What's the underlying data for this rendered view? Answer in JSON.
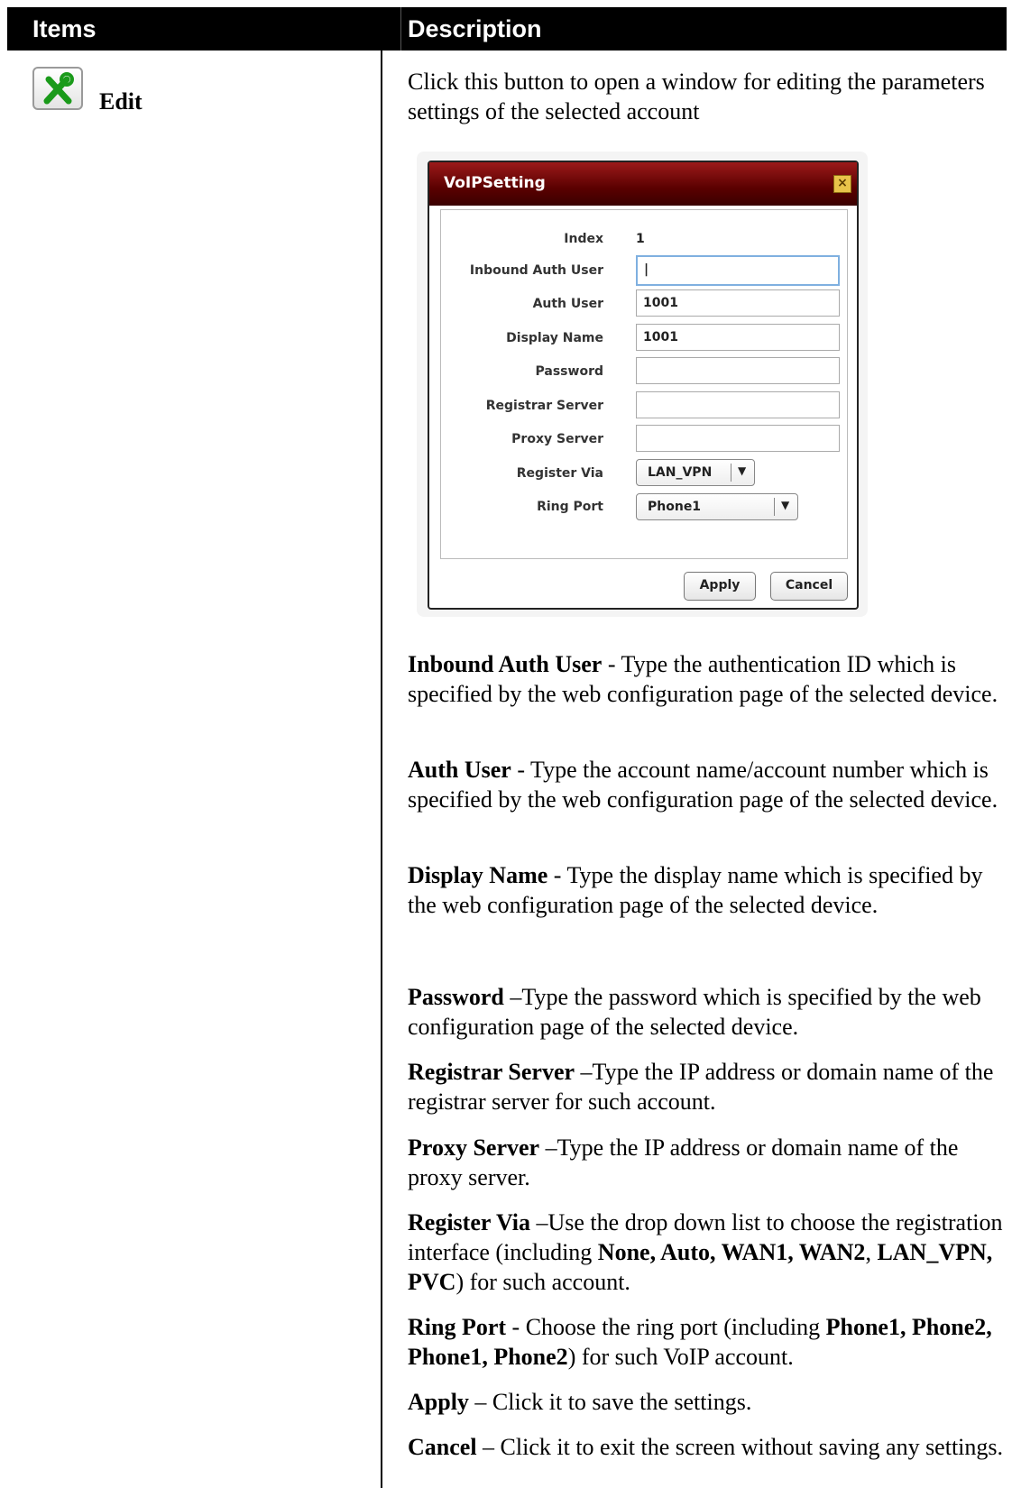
{
  "table": {
    "header_items": "Items",
    "header_description": "Description"
  },
  "item": {
    "icon": "edit-tools-icon",
    "label": "Edit"
  },
  "intro": "Click this button to open a window for editing the parameters settings of the selected account",
  "dialog": {
    "title": "VoIPSetting",
    "fields": {
      "index_label": "Index",
      "index_value": "1",
      "inbound_auth_user_label": "Inbound Auth User",
      "inbound_auth_user_value": "|",
      "auth_user_label": "Auth User",
      "auth_user_value": "1001",
      "display_name_label": "Display Name",
      "display_name_value": "1001",
      "password_label": "Password",
      "password_value": "",
      "registrar_server_label": "Registrar Server",
      "registrar_server_value": "",
      "proxy_server_label": "Proxy Server",
      "proxy_server_value": "",
      "register_via_label": "Register Via",
      "register_via_value": "LAN_VPN",
      "ring_port_label": "Ring Port",
      "ring_port_value": "Phone1"
    },
    "apply_label": "Apply",
    "cancel_label": "Cancel"
  },
  "descriptions": {
    "inbound_term": "Inbound Auth User",
    "inbound_text": " - Type the authentication ID which is specified by the web configuration page of the selected device.",
    "auth_term": "Auth User",
    "auth_text": " - Type the account name/account number which is specified by the web configuration page of the selected device.",
    "display_term": "Display Name",
    "display_text": " - Type the display name which is specified by the web configuration page of the selected device.",
    "password_term": "Password",
    "password_text": " –Type the password which is specified by the web configuration page of the selected device.",
    "registrar_term": "Registrar Server",
    "registrar_text": " –Type the IP address or domain name of the registrar server for such account.",
    "proxy_term": "Proxy Server",
    "proxy_text": " –Type the IP address or domain name of the proxy server.",
    "via_term": "Register Via",
    "via_text1": " –Use the drop down list to choose the registration interface (including ",
    "via_bold1": "None, Auto, WAN1, WAN2",
    "via_comma": ", ",
    "via_bold2": "LAN_VPN, PVC",
    "via_text2": ") for such account.",
    "ring_term": "Ring Port",
    "ring_text1": " - Choose the ring port (including ",
    "ring_bold": "Phone1, Phone2, Phone1, Phone2",
    "ring_text2": ") for such VoIP account.",
    "apply_term": "Apply",
    "apply_text": " – Click it to save the settings.",
    "cancel_term": "Cancel",
    "cancel_text": " – Click it to exit the screen without saving any settings."
  }
}
